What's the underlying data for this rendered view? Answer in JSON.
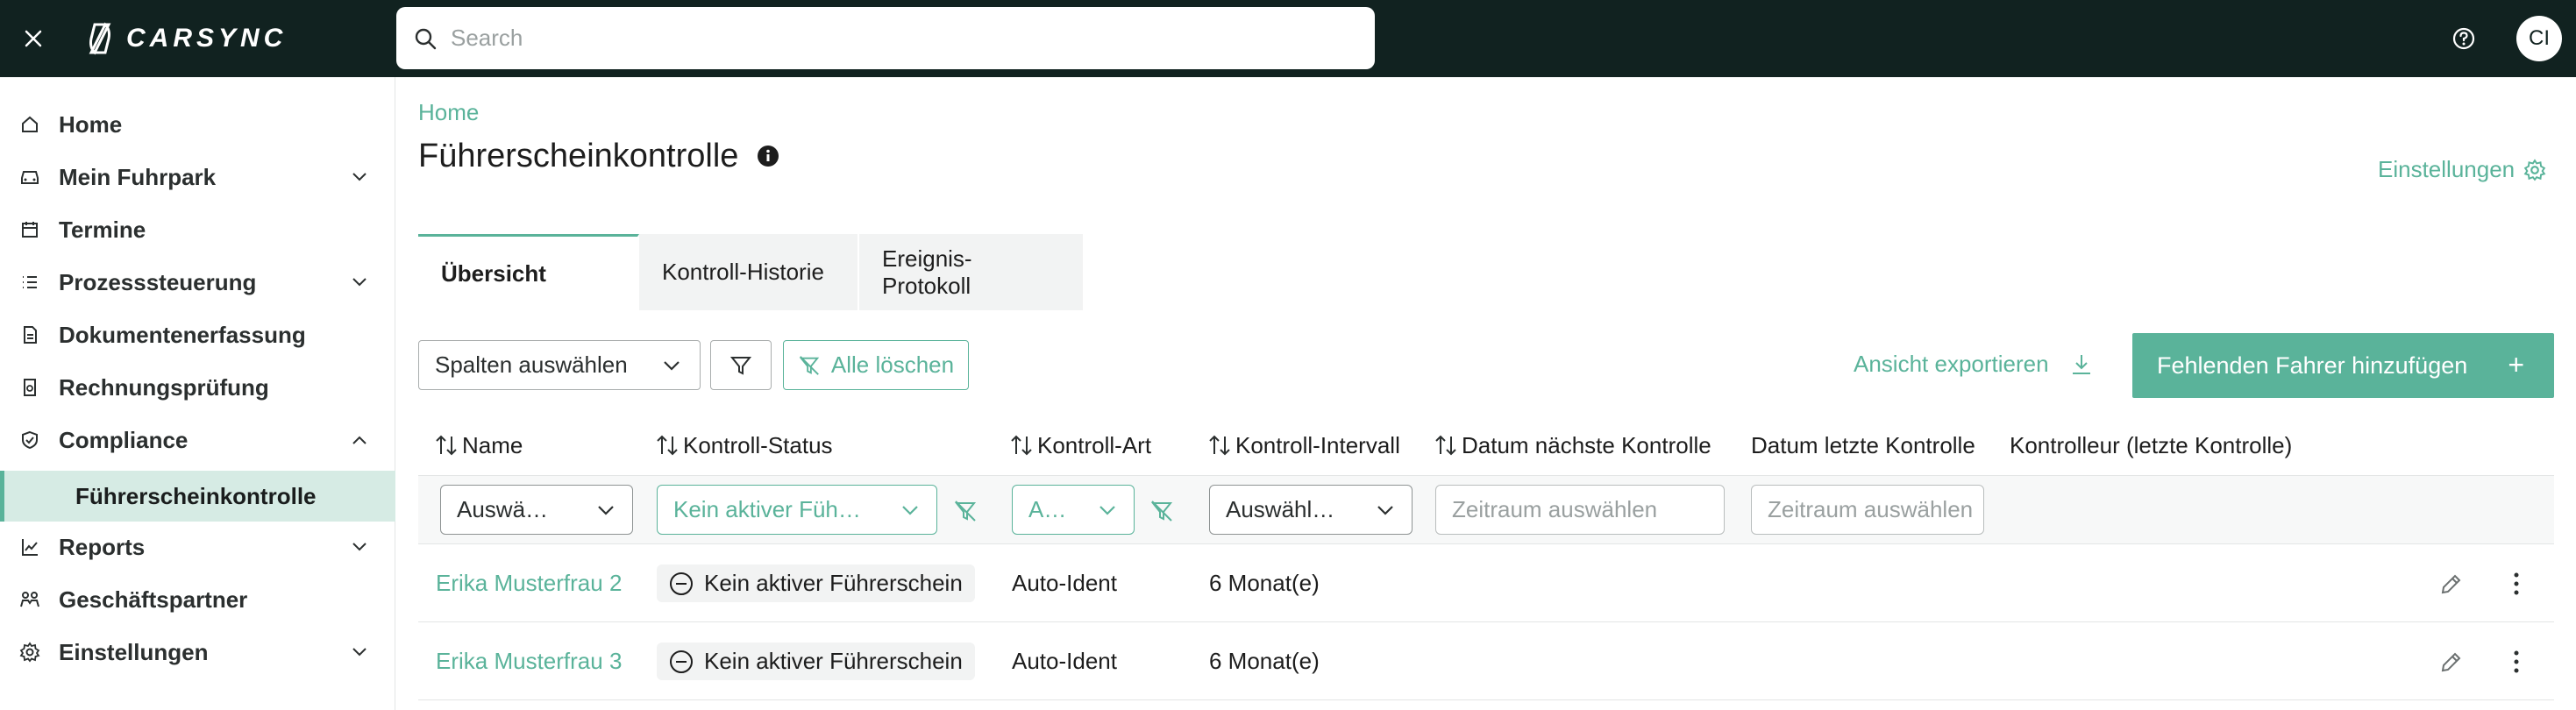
{
  "app": {
    "logo_text": "CARSYNC"
  },
  "search": {
    "placeholder": "Search"
  },
  "user": {
    "initials": "CI"
  },
  "sidebar": {
    "items": [
      {
        "label": "Home",
        "icon": "home-icon"
      },
      {
        "label": "Mein Fuhrpark",
        "icon": "car-icon",
        "expandable": true
      },
      {
        "label": "Termine",
        "icon": "calendar-icon"
      },
      {
        "label": "Prozesssteuerung",
        "icon": "list-icon",
        "expandable": true
      },
      {
        "label": "Dokumentenerfassung",
        "icon": "document-icon"
      },
      {
        "label": "Rechnungsprüfung",
        "icon": "invoice-icon"
      },
      {
        "label": "Compliance",
        "icon": "shield-check-icon",
        "expanded": true
      },
      {
        "label": "Reports",
        "icon": "chart-icon",
        "expandable": true
      },
      {
        "label": "Geschäftspartner",
        "icon": "partners-icon"
      },
      {
        "label": "Einstellungen",
        "icon": "gear-icon",
        "expandable": true
      }
    ],
    "sub_items": [
      {
        "label": "Führerscheinkontrolle",
        "selected": true
      }
    ]
  },
  "breadcrumb": {
    "home": "Home"
  },
  "page": {
    "title": "Führerscheinkontrolle",
    "settings_label": "Einstellungen"
  },
  "tabs": [
    {
      "label": "Übersicht",
      "active": true
    },
    {
      "label": "Kontroll-Historie"
    },
    {
      "label": "Ereignis-Protokoll"
    }
  ],
  "toolbar": {
    "columns_select": "Spalten auswählen",
    "clear_all": "Alle löschen",
    "export": "Ansicht exportieren",
    "add_driver": "Fehlenden Fahrer hinzufügen",
    "add_plus": "+"
  },
  "table": {
    "columns": [
      "Name",
      "Kontroll-Status",
      "Kontroll-Art",
      "Kontroll-Intervall",
      "Datum nächste Kontrolle",
      "Datum letzte Kontrolle",
      "Kontrolleur (letzte Kontrolle)"
    ],
    "filters": {
      "name": "Auswä…",
      "status": "Kein aktiver Füh…",
      "art": "A…",
      "intervall": "Auswähl…",
      "next_date_placeholder": "Zeitraum auswählen",
      "last_date_placeholder": "Zeitraum auswählen"
    },
    "rows": [
      {
        "name": "Erika Musterfrau 2",
        "status": "Kein aktiver Führerschein",
        "art": "Auto-Ident",
        "intervall": "6 Monat(e)"
      },
      {
        "name": "Erika Musterfrau 3",
        "status": "Kein aktiver Führerschein",
        "art": "Auto-Ident",
        "intervall": "6 Monat(e)"
      }
    ]
  },
  "colors": {
    "topbar": "#112220",
    "accent": "#5ab39a",
    "selected_bg": "#d6ebe4"
  }
}
